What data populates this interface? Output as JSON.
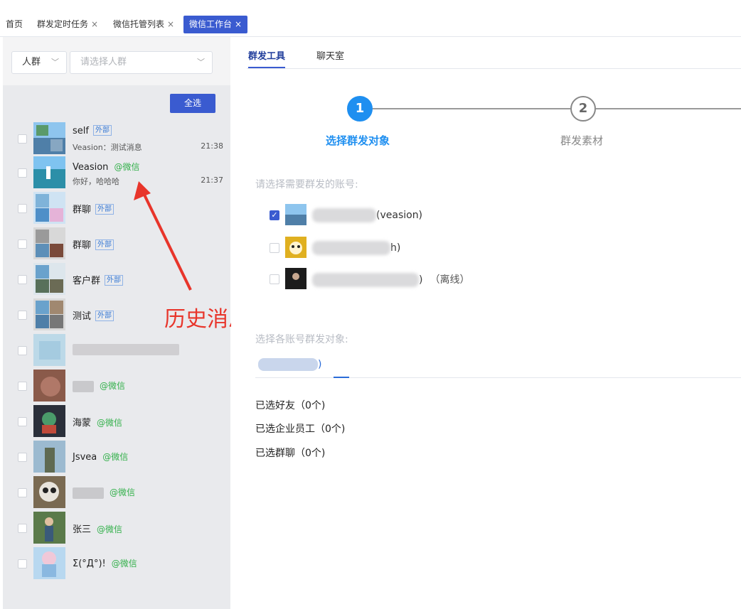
{
  "tabs": [
    {
      "label": "首页",
      "closable": false
    },
    {
      "label": "群发定时任务",
      "closable": true
    },
    {
      "label": "微信托管列表",
      "closable": true
    },
    {
      "label": "微信工作台",
      "closable": true,
      "active": true
    }
  ],
  "close_glyph": "×",
  "left": {
    "group_select": "人群",
    "crowd_placeholder": "请选择人群",
    "select_all": "全选",
    "items": [
      {
        "name": "self",
        "tag": "外部",
        "msg": "Veasion：测试消息",
        "time": "21:38"
      },
      {
        "name": "Veasion",
        "wechat": "@微信",
        "msg": "你好，哈哈哈",
        "time": "21:37"
      },
      {
        "name": "群聊",
        "tag": "外部"
      },
      {
        "name": "群聊",
        "tag": "外部"
      },
      {
        "name": "客户群",
        "tag": "外部"
      },
      {
        "name": "测试",
        "tag": "外部"
      },
      {
        "name": ""
      },
      {
        "name": "",
        "wechat": "@微信"
      },
      {
        "name": "海蒙",
        "wechat": "@微信"
      },
      {
        "name": "Jsvea",
        "wechat": "@微信"
      },
      {
        "name": "",
        "wechat": "@微信"
      },
      {
        "name": "张三",
        "wechat": "@微信"
      },
      {
        "name": "Σ(°Д°)!",
        "wechat": "@微信"
      }
    ]
  },
  "right": {
    "tabs": [
      "群发工具",
      "聊天室"
    ],
    "steps": [
      {
        "num": "1",
        "label": "选择群发对象"
      },
      {
        "num": "2",
        "label": "群发素材"
      }
    ],
    "account_hint": "请选择需要群发的账号:",
    "accounts": [
      {
        "suffix": "(veasion)",
        "checked": true
      },
      {
        "suffix": "h)",
        "checked": false
      },
      {
        "suffix": ")",
        "status": "（离线）",
        "checked": false
      }
    ],
    "target_hint": "选择各账号群发对象:",
    "subtab": ")",
    "selected": [
      "已选好友（0个)",
      "已选企业员工（0个)",
      "已选群聊（0个)"
    ]
  },
  "annotation": "历史消息",
  "colors": {
    "primary": "#3a5bd0",
    "accent": "#1f8ff0",
    "wechat": "#32b04a",
    "annotation": "#e8352b"
  }
}
